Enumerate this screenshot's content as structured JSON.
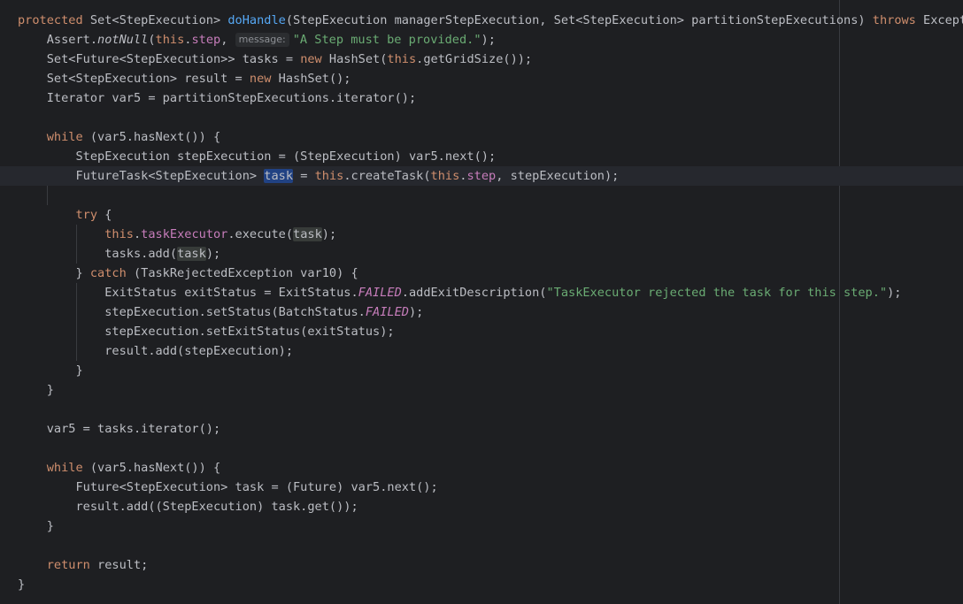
{
  "editor": {
    "language": "java",
    "parameter_hint": "message:",
    "lines": [
      {
        "t": [
          "protected",
          " Set<StepExecution> ",
          "doHandle",
          "(StepExecution managerStepExecution, Set<StepExecution> partitionStepExecutions) ",
          "throws",
          " Exception {"
        ]
      },
      {
        "t": [
          "    Assert.",
          "notNull",
          "(",
          "this",
          ".",
          "step",
          ", ",
          "\"A Step must be provided.\"",
          ");"
        ]
      },
      {
        "t": [
          "    Set<Future<StepExecution>> tasks = ",
          "new",
          " HashSet(",
          "this",
          ".getGridSize());"
        ]
      },
      {
        "t": [
          "    Set<StepExecution> result = ",
          "new",
          " HashSet();"
        ]
      },
      {
        "t": [
          "    Iterator var5 = partitionStepExecutions.iterator();"
        ]
      },
      {
        "t": [
          ""
        ]
      },
      {
        "t": [
          "    ",
          "while",
          " (var5.hasNext()) {"
        ]
      },
      {
        "t": [
          "        StepExecution stepExecution = (StepExecution) var5.next();"
        ]
      },
      {
        "t": [
          "        FutureTask<StepExecution> ",
          "task",
          " = ",
          "this",
          ".createTask(",
          "this",
          ".",
          "step",
          ", stepExecution);"
        ]
      },
      {
        "t": [
          ""
        ]
      },
      {
        "t": [
          "        ",
          "try",
          " {"
        ]
      },
      {
        "t": [
          "            ",
          "this",
          ".",
          "taskExecutor",
          ".execute(",
          "task",
          ");"
        ]
      },
      {
        "t": [
          "            tasks.add(",
          "task",
          ");"
        ]
      },
      {
        "t": [
          "        } ",
          "catch",
          " (TaskRejectedException var10) {"
        ]
      },
      {
        "t": [
          "            ExitStatus exitStatus = ExitStatus.",
          "FAILED",
          ".addExitDescription(",
          "\"TaskExecutor rejected the task for this step.\"",
          ");"
        ]
      },
      {
        "t": [
          "            stepExecution.setStatus(BatchStatus.",
          "FAILED",
          ");"
        ]
      },
      {
        "t": [
          "            stepExecution.setExitStatus(exitStatus);"
        ]
      },
      {
        "t": [
          "            result.add(stepExecution);"
        ]
      },
      {
        "t": [
          "        }"
        ]
      },
      {
        "t": [
          "    }"
        ]
      },
      {
        "t": [
          ""
        ]
      },
      {
        "t": [
          "    var5 = tasks.iterator();"
        ]
      },
      {
        "t": [
          ""
        ]
      },
      {
        "t": [
          "    ",
          "while",
          " (var5.hasNext()) {"
        ]
      },
      {
        "t": [
          "        Future<StepExecution> task = (Future) var5.next();"
        ]
      },
      {
        "t": [
          "        result.add((StepExecution) task.get());"
        ]
      },
      {
        "t": [
          "    }"
        ]
      },
      {
        "t": [
          ""
        ]
      },
      {
        "t": [
          "    ",
          "return",
          " result;"
        ]
      },
      {
        "t": [
          "}"
        ]
      }
    ]
  }
}
